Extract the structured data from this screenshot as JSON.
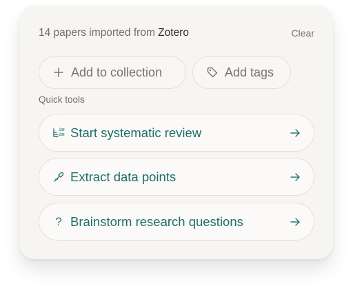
{
  "header": {
    "prefix": "14 papers imported from",
    "source": "Zotero",
    "clear_label": "Clear"
  },
  "actions": {
    "add_collection_label": "Add to collection",
    "add_tags_label": "Add tags",
    "add_collection_icon": "plus-icon",
    "add_tags_icon": "tag-icon"
  },
  "quick_tools": {
    "section_label": "Quick tools",
    "items": [
      {
        "label": "Start systematic review",
        "icon": "numbered-list-icon"
      },
      {
        "label": "Extract data points",
        "icon": "eyedropper-icon"
      },
      {
        "label": "Brainstorm research questions",
        "icon": "question-mark-icon"
      }
    ],
    "arrow_icon": "arrow-right-icon"
  },
  "colors": {
    "accent": "#1f6e6c",
    "muted_text": "#6f6d69",
    "card_background": "#f6f5f1"
  }
}
